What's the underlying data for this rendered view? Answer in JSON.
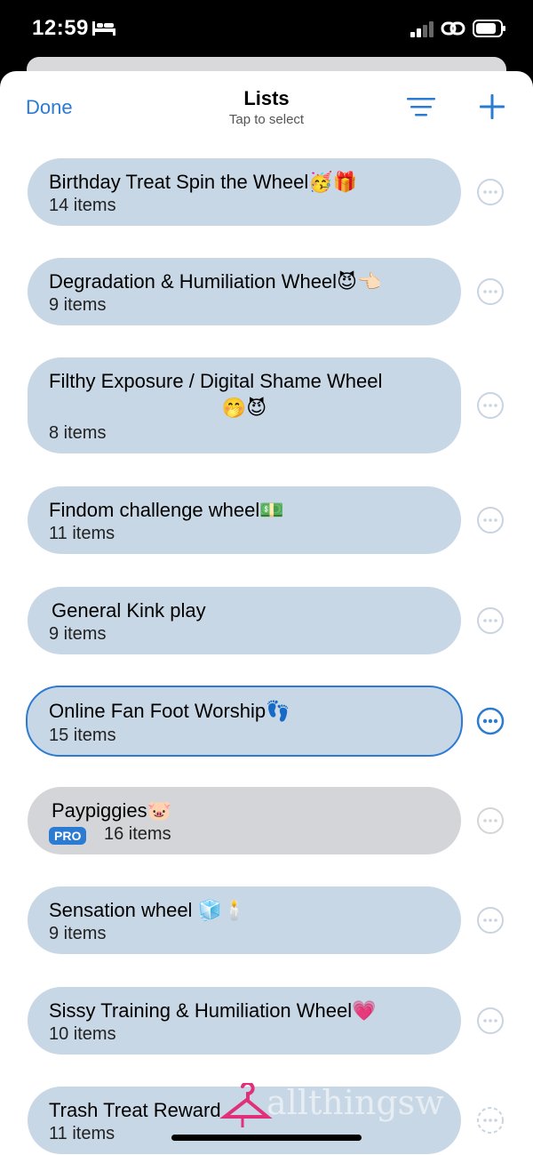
{
  "status": {
    "time": "12:59"
  },
  "nav": {
    "done_label": "Done",
    "title": "Lists",
    "subtitle": "Tap to select"
  },
  "lists": [
    {
      "title": "Birthday Treat Spin the Wheel🥳🎁",
      "count": "14 items"
    },
    {
      "title": "Degradation & Humiliation Wheel😈👈🏻",
      "count": "9 items"
    },
    {
      "title_line1": "Filthy Exposure / Digital Shame Wheel",
      "title_line2": "🤭😈",
      "count": "8 items"
    },
    {
      "title": "Findom challenge wheel💵",
      "count": "11 items"
    },
    {
      "title": "General Kink play",
      "count": "9 items"
    },
    {
      "title": "Online Fan Foot Worship👣",
      "count": "15 items"
    },
    {
      "title": "Paypiggies🐷",
      "count": "16 items",
      "badge": "PRO"
    },
    {
      "title": "Sensation wheel 🧊🕯️",
      "count": "9 items"
    },
    {
      "title": "Sissy Training & Humiliation Wheel💗",
      "count": "10 items"
    },
    {
      "title": "Trash Treat Reward",
      "count": "11 items"
    }
  ],
  "watermark": "allthingsw",
  "colors": {
    "accent": "#2b7bd3",
    "card": "#c8d7e5",
    "card_locked": "#d4d5d8"
  }
}
